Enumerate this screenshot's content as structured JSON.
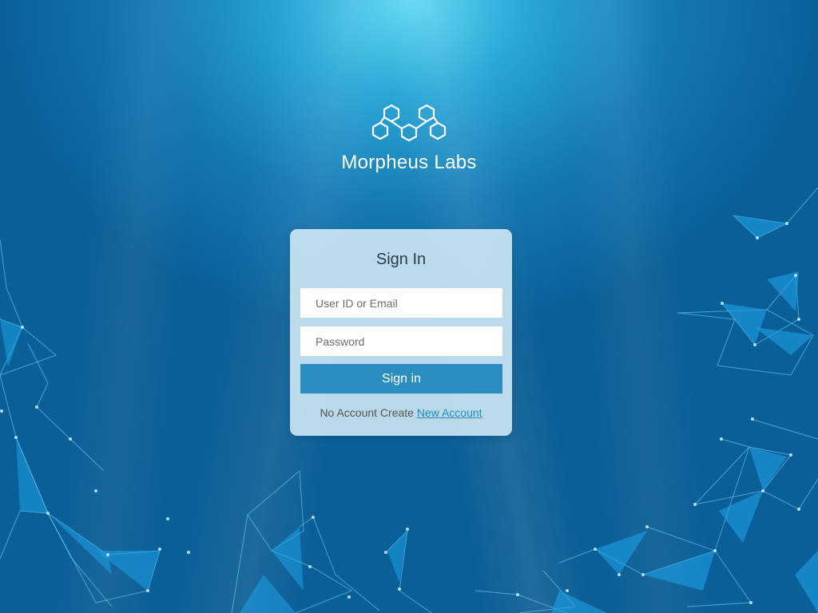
{
  "brand": {
    "name": "Morpheus Labs",
    "logo_icon": "hexagon-molecule-icon"
  },
  "signin": {
    "title": "Sign In",
    "user_placeholder": "User ID or Email",
    "password_placeholder": "Password",
    "button_label": "Sign in",
    "no_account_text": "No Account Create",
    "new_account_link": "New Account"
  },
  "colors": {
    "button": "#2a8fc0",
    "link": "#1f8cc0",
    "card": "#d6eef7",
    "background_top": "#5fd8f4",
    "background_bottom": "#0b5f97"
  }
}
